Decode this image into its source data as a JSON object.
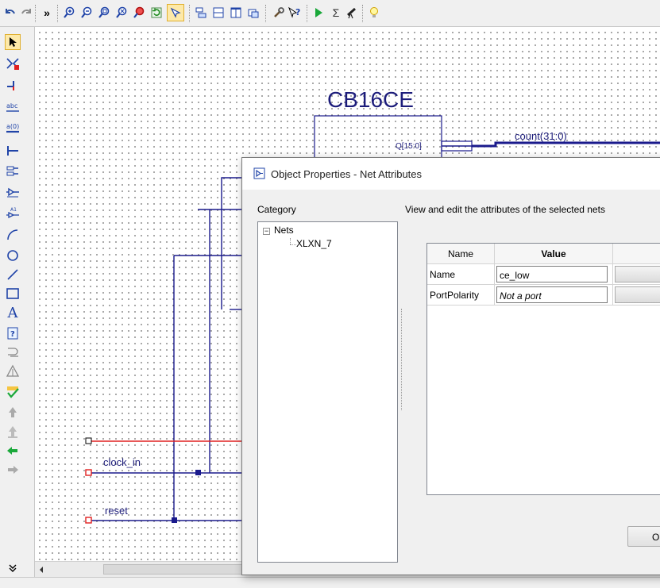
{
  "toolbar": {
    "overflow": "»",
    "icons": [
      "undo-icon",
      "redo-icon",
      "zoom-in-icon",
      "zoom-out-icon",
      "zoom-full-icon",
      "zoom-fit-icon",
      "zoom-selection-icon",
      "refresh-icon",
      "select-mode-icon",
      "align-left-icon",
      "align-rows-icon",
      "align-columns-icon",
      "window-icon",
      "settings-icon",
      "help-cursor-icon",
      "run-icon",
      "sum-icon",
      "telescope-icon",
      "tip-icon"
    ]
  },
  "left_toolbar": {
    "tools": [
      "select-arrow-icon",
      "add-net-icon",
      "add-wire-icon",
      "net-name-icon",
      "bus-name-icon",
      "bus-tap-icon",
      "add-io-marker-icon",
      "add-symbol-icon",
      "add-instance-icon",
      "arc-icon",
      "circle-icon",
      "line-icon",
      "rectangle-icon",
      "text-icon",
      "symbol-info-icon",
      "add-symbol-pin-icon",
      "hierarchy-icon",
      "check-icon",
      "push-icon",
      "pop-icon",
      "back-icon",
      "forward-icon",
      "more-icon"
    ],
    "text_tool_label": "A"
  },
  "schematic": {
    "component_name": "CB16CE",
    "pin_label": "Q[15:0]",
    "bus_label": "count(31:0)",
    "net_clock": "clock_in",
    "net_reset": "reset"
  },
  "dialog": {
    "title": "Object Properties - Net Attributes",
    "category_label": "Category",
    "description": "View and edit the attributes of the selected nets",
    "tree": {
      "root": "Nets",
      "child": "XLXN_7"
    },
    "grid": {
      "headers": [
        "Name",
        "Value"
      ],
      "rows": [
        {
          "name": "Name",
          "value": "ce_low"
        },
        {
          "name": "PortPolarity",
          "value": "Not a port"
        }
      ]
    },
    "ok_button": "O"
  },
  "colors": {
    "wire_blue": "#1a1a8c",
    "wire_red": "#e02020",
    "component_title": "#1c1c7a"
  }
}
